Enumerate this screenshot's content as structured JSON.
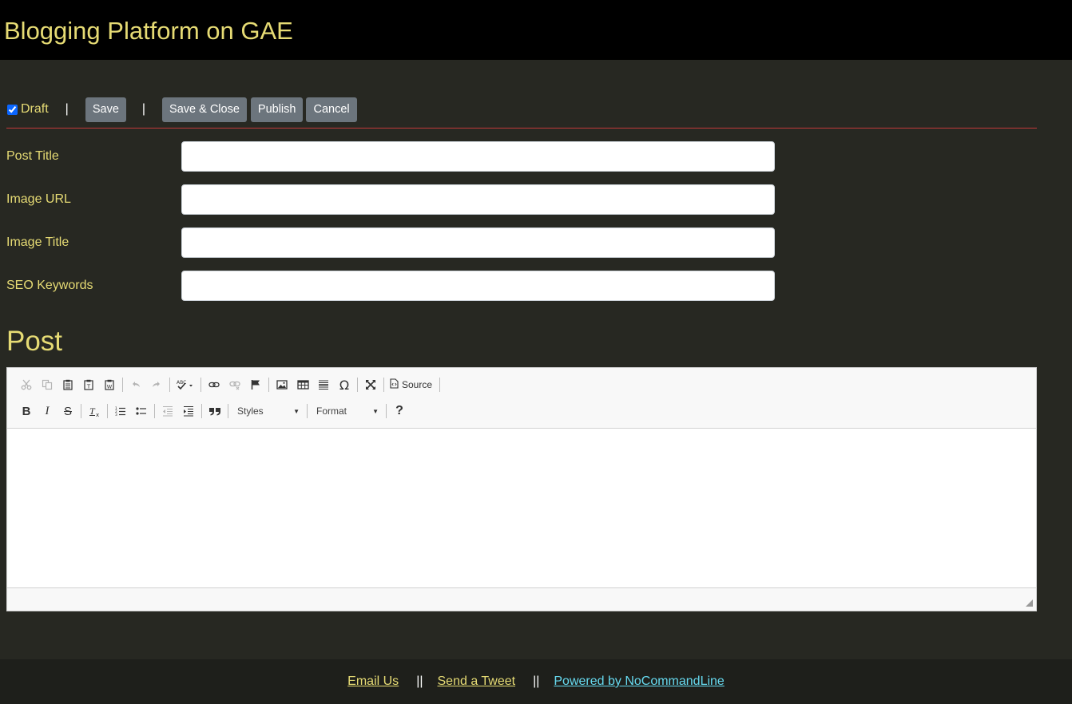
{
  "app": {
    "title": "Blogging Platform on GAE"
  },
  "toolbar": {
    "draft_label": "Draft",
    "draft_checked": true,
    "separator": "|",
    "save_label": "Save",
    "save_close_label": "Save & Close",
    "publish_label": "Publish",
    "cancel_label": "Cancel"
  },
  "form": {
    "fields": [
      {
        "label": "Post Title",
        "value": ""
      },
      {
        "label": "Image URL",
        "value": ""
      },
      {
        "label": "Image Title",
        "value": ""
      },
      {
        "label": "SEO Keywords",
        "value": ""
      }
    ]
  },
  "post": {
    "heading": "Post"
  },
  "editor": {
    "row1": [
      "cut-icon",
      "copy-icon",
      "paste-icon",
      "paste-text-icon",
      "paste-word-icon",
      "undo-icon",
      "redo-icon",
      "spellcheck-icon",
      "link-icon",
      "unlink-icon",
      "anchor-icon",
      "image-icon",
      "table-icon",
      "horizontal-rule-icon",
      "special-char-icon",
      "maximize-icon",
      "source-icon"
    ],
    "source_label": "Source",
    "special_char_glyph": "Ω",
    "help_glyph": "?",
    "bold_glyph": "B",
    "italic_glyph": "I",
    "strike_glyph": "S",
    "styles_label": "Styles",
    "format_label": "Format",
    "content": ""
  },
  "footer": {
    "email_label": "Email Us",
    "tweet_label": "Send a Tweet",
    "powered_label": "Powered by NoCommandLine",
    "separator": "||"
  },
  "colors": {
    "accent": "#e6db74",
    "background": "#272822",
    "link_cyan": "#66d9ef",
    "button": "#6c757d",
    "rule": "#c23a3a"
  }
}
